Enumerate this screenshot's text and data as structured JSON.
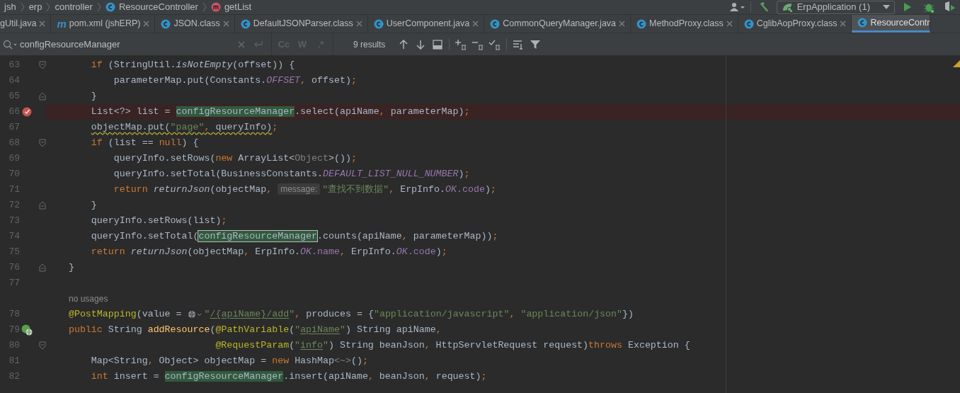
{
  "breadcrumb": [
    {
      "label": "jsh",
      "kind": "package"
    },
    {
      "label": "erp",
      "kind": "package"
    },
    {
      "label": "controller",
      "kind": "package"
    },
    {
      "label": "ResourceController",
      "kind": "class"
    },
    {
      "label": "getList",
      "kind": "method"
    }
  ],
  "toolbar": {
    "run_config": "ErpApplication (1)"
  },
  "tabs": [
    {
      "label": "gUtil.java",
      "kind": "cut",
      "selected": false
    },
    {
      "label": "pom.xml (jshERP)",
      "kind": "maven",
      "icon_text": "m",
      "selected": false
    },
    {
      "label": "JSON.class",
      "kind": "class",
      "selected": false
    },
    {
      "label": "DefaultJSONParser.class",
      "kind": "class",
      "selected": false
    },
    {
      "label": "UserComponent.java",
      "kind": "class",
      "selected": false
    },
    {
      "label": "CommonQueryManager.java",
      "kind": "class",
      "selected": false
    },
    {
      "label": "MethodProxy.class",
      "kind": "class",
      "selected": false
    },
    {
      "label": "CglibAopProxy.class",
      "kind": "class",
      "selected": false
    },
    {
      "label": "ResourceContr",
      "kind": "class",
      "selected": true
    }
  ],
  "find": {
    "value": "configResourceManager",
    "options": [
      {
        "label": "Cc"
      },
      {
        "label": "W"
      },
      {
        "label": ".*"
      }
    ],
    "results": "9 results"
  },
  "lines": [
    {
      "kind": "code",
      "number": "63",
      "fold_start": true,
      "tokens": [
        {
          "kind": "kw",
          "text": "        if"
        },
        {
          "kind": "p",
          "text": " (StringUtil."
        },
        {
          "kind": "ital",
          "text": "isNotEmpty"
        },
        {
          "kind": "p",
          "text": "(offset)) {"
        }
      ]
    },
    {
      "kind": "code",
      "number": "64",
      "tokens": [
        {
          "kind": "p",
          "text": "            parameterMap.put(Constants."
        },
        {
          "kind": "const",
          "text": "OFFSET"
        },
        {
          "kind": "p",
          "text": ", offset);"
        }
      ]
    },
    {
      "kind": "code",
      "number": "65",
      "fold_end": true,
      "tokens": [
        {
          "kind": "p",
          "text": "        }"
        }
      ]
    },
    {
      "kind": "code",
      "number": "66",
      "breakpoint": true,
      "tokens": [
        {
          "kind": "p",
          "text": "        List<?> list = "
        },
        {
          "kind": "match",
          "text": "configResourceManager"
        },
        {
          "kind": "p",
          "text": ".select(apiName, parameterMap);"
        }
      ]
    },
    {
      "kind": "code",
      "number": "67",
      "tokens": [
        {
          "kind": "p",
          "text": "        objectMap.put(",
          "warn": true
        },
        {
          "kind": "str",
          "text": "\"page\"",
          "warn": true
        },
        {
          "kind": "p",
          "text": ", queryInfo)",
          "warn": true
        },
        {
          "kind": "p",
          "text": ";"
        }
      ]
    },
    {
      "kind": "code",
      "number": "68",
      "fold_start": true,
      "tokens": [
        {
          "kind": "kw",
          "text": "        if"
        },
        {
          "kind": "p",
          "text": " (list == "
        },
        {
          "kind": "kw",
          "text": "null"
        },
        {
          "kind": "p",
          "text": ") {"
        }
      ]
    },
    {
      "kind": "code",
      "number": "69",
      "tokens": [
        {
          "kind": "p",
          "text": "            queryInfo.setRows("
        },
        {
          "kind": "kw",
          "text": "new"
        },
        {
          "kind": "p",
          "text": " ArrayList<"
        },
        {
          "kind": "gray",
          "text": "Object"
        },
        {
          "kind": "p",
          "text": ">());"
        }
      ]
    },
    {
      "kind": "code",
      "number": "70",
      "tokens": [
        {
          "kind": "p",
          "text": "            queryInfo.setTotal(BusinessConstants."
        },
        {
          "kind": "const",
          "text": "DEFAULT_LIST_NULL_NUMBER"
        },
        {
          "kind": "p",
          "text": ");"
        }
      ]
    },
    {
      "kind": "code",
      "number": "71",
      "tokens": [
        {
          "kind": "kw",
          "text": "            return "
        },
        {
          "kind": "ital",
          "text": "returnJson"
        },
        {
          "kind": "p",
          "text": "(objectMap, "
        },
        {
          "kind": "hint",
          "text": "message:"
        },
        {
          "kind": "str",
          "text": "\"查找不到数据\""
        },
        {
          "kind": "p",
          "text": ", ErpInfo."
        },
        {
          "kind": "const",
          "text": "OK"
        },
        {
          "kind": "field",
          "text": ".code"
        },
        {
          "kind": "p",
          "text": ");"
        }
      ]
    },
    {
      "kind": "code",
      "number": "72",
      "fold_end": true,
      "tokens": [
        {
          "kind": "p",
          "text": "        }"
        }
      ]
    },
    {
      "kind": "code",
      "number": "73",
      "tokens": [
        {
          "kind": "p",
          "text": "        queryInfo.setRows(list);"
        }
      ]
    },
    {
      "kind": "code",
      "number": "74",
      "tokens": [
        {
          "kind": "p",
          "text": "        queryInfo.setTotal("
        },
        {
          "kind": "current",
          "text": "configResourceManager"
        },
        {
          "kind": "p",
          "text": ".counts(apiName, parameterMap));"
        }
      ]
    },
    {
      "kind": "code",
      "number": "75",
      "tokens": [
        {
          "kind": "kw",
          "text": "        return "
        },
        {
          "kind": "ital",
          "text": "returnJson"
        },
        {
          "kind": "p",
          "text": "(objectMap, ErpInfo."
        },
        {
          "kind": "const",
          "text": "OK"
        },
        {
          "kind": "field",
          "text": ".name"
        },
        {
          "kind": "p",
          "text": ", ErpInfo."
        },
        {
          "kind": "const",
          "text": "OK"
        },
        {
          "kind": "field",
          "text": ".code"
        },
        {
          "kind": "p",
          "text": ");"
        }
      ]
    },
    {
      "kind": "code",
      "number": "76",
      "fold_end": true,
      "tokens": [
        {
          "kind": "p",
          "text": "    }"
        }
      ]
    },
    {
      "kind": "code",
      "number": "77"
    },
    {
      "kind": "inlay",
      "text": "no usages"
    },
    {
      "kind": "code",
      "number": "78",
      "tokens": [
        {
          "kind": "annot",
          "text": "    @PostMapping"
        },
        {
          "kind": "p",
          "text": "(value = "
        },
        {
          "kind": "globe"
        },
        {
          "kind": "str",
          "text": "\""
        },
        {
          "kind": "strU",
          "text": "/{apiName}/add"
        },
        {
          "kind": "str",
          "text": "\""
        },
        {
          "kind": "p",
          "text": ", produces = {"
        },
        {
          "kind": "str",
          "text": "\"application/javascript\""
        },
        {
          "kind": "p",
          "text": ", "
        },
        {
          "kind": "str",
          "text": "\"application/json\""
        },
        {
          "kind": "p",
          "text": "})"
        }
      ]
    },
    {
      "kind": "code",
      "number": "79",
      "endpoint": true,
      "tokens": [
        {
          "kind": "kw",
          "text": "    public"
        },
        {
          "kind": "p",
          "text": " String "
        },
        {
          "kind": "decl",
          "text": "addResource"
        },
        {
          "kind": "p",
          "text": "("
        },
        {
          "kind": "annot",
          "text": "@PathVariable"
        },
        {
          "kind": "p",
          "text": "("
        },
        {
          "kind": "str",
          "text": "\""
        },
        {
          "kind": "strU",
          "text": "apiName"
        },
        {
          "kind": "str",
          "text": "\""
        },
        {
          "kind": "p",
          "text": ") String apiName,"
        }
      ]
    },
    {
      "kind": "code",
      "number": "80",
      "fold_start": true,
      "tokens": [
        {
          "kind": "annot",
          "text": "                              @RequestParam"
        },
        {
          "kind": "p",
          "text": "("
        },
        {
          "kind": "str",
          "text": "\""
        },
        {
          "kind": "strU",
          "text": "info"
        },
        {
          "kind": "str",
          "text": "\""
        },
        {
          "kind": "p",
          "text": ") String beanJson, HttpServletRequest request)"
        },
        {
          "kind": "kw",
          "text": "throws"
        },
        {
          "kind": "p",
          "text": " Exception {"
        }
      ]
    },
    {
      "kind": "code",
      "number": "81",
      "tokens": [
        {
          "kind": "p",
          "text": "        Map<String, Object> objectMap = "
        },
        {
          "kind": "kw",
          "text": "new"
        },
        {
          "kind": "p",
          "text": " HashMap"
        },
        {
          "kind": "gray",
          "text": "<~>"
        },
        {
          "kind": "p",
          "text": "();"
        }
      ]
    },
    {
      "kind": "code",
      "number": "82",
      "tokens": [
        {
          "kind": "kw",
          "text": "        int"
        },
        {
          "kind": "p",
          "text": " insert = "
        },
        {
          "kind": "match",
          "text": "configResourceManager"
        },
        {
          "kind": "p",
          "text": ".insert(apiName, beanJson, request);"
        }
      ]
    }
  ]
}
